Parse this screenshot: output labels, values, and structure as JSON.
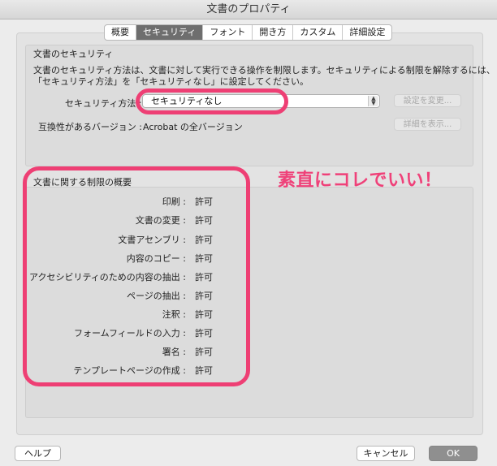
{
  "window": {
    "title": "文書のプロパティ"
  },
  "tabs": [
    {
      "label": "概要",
      "active": false
    },
    {
      "label": "セキュリティ",
      "active": true
    },
    {
      "label": "フォント",
      "active": false
    },
    {
      "label": "開き方",
      "active": false
    },
    {
      "label": "カスタム",
      "active": false
    },
    {
      "label": "詳細設定",
      "active": false
    }
  ],
  "security": {
    "heading": "文書のセキュリティ",
    "description_line1": "文書のセキュリティ方法は、文書に対して実行できる操作を制限します。セキュリティによる制限を解除するには、",
    "description_line2": "「セキュリティ方法」を「セキュリティなし」に設定してください。",
    "method_label": "セキュリティ方法 :",
    "method_value": "セキュリティなし",
    "change_settings_button": "設定を変更...",
    "compat_label": "互換性があるバージョン :",
    "compat_value": "Acrobat の全バージョン",
    "show_details_button": "詳細を表示..."
  },
  "restrictions": {
    "heading": "文書に関する制限の概要",
    "rows": [
      {
        "label": "印刷 :",
        "value": "許可"
      },
      {
        "label": "文書の変更 :",
        "value": "許可"
      },
      {
        "label": "文書アセンブリ :",
        "value": "許可"
      },
      {
        "label": "内容のコピー :",
        "value": "許可"
      },
      {
        "label": "アクセシビリティのための内容の抽出 :",
        "value": "許可"
      },
      {
        "label": "ページの抽出 :",
        "value": "許可"
      },
      {
        "label": "注釈 :",
        "value": "許可"
      },
      {
        "label": "フォームフィールドの入力 :",
        "value": "許可"
      },
      {
        "label": "署名 :",
        "value": "許可"
      },
      {
        "label": "テンプレートページの作成 :",
        "value": "許可"
      }
    ]
  },
  "annotation": {
    "text": "素直にコレでいい！",
    "color": "#ef4179"
  },
  "footer": {
    "help_button": "ヘルプ",
    "cancel_button": "キャンセル",
    "ok_button": "OK"
  }
}
